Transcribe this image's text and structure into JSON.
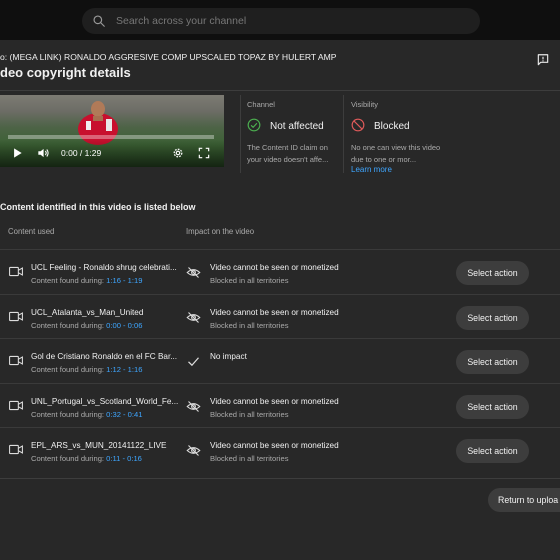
{
  "search": {
    "placeholder": "Search across your channel"
  },
  "dialog": {
    "subtitle": "o: (MEGA LINK) RONALDO AGGRESIVE COMP UPSCALED TOPAZ BY HULERT AMP",
    "title": "deo copyright details"
  },
  "video": {
    "time": "0:00 / 1:29",
    "progress": 0
  },
  "channel": {
    "label": "Channel",
    "value": "Not affected",
    "description": "The Content ID claim on your video doesn't affe..."
  },
  "visibility": {
    "label": "Visibility",
    "value": "Blocked",
    "description": "No one can view this video due to one or mor...",
    "link": "Learn more"
  },
  "content": {
    "section_title": "Content identified in this video is listed below",
    "col_content": "Content used",
    "col_impact": "Impact on the video",
    "found_label": "Content found during: ",
    "rows": [
      {
        "name": "UCL Feeling - Ronaldo shrug celebrati...",
        "range": "1:16 - 1:19",
        "impact_icon": "eye-off-icon",
        "impact_title": "Video cannot be seen or monetized",
        "impact_sub": "Blocked in all territories",
        "action": "Select action"
      },
      {
        "name": "UCL_Atalanta_vs_Man_United",
        "range": "0:00 - 0:06",
        "impact_icon": "eye-off-icon",
        "impact_title": "Video cannot be seen or monetized",
        "impact_sub": "Blocked in all territories",
        "action": "Select action"
      },
      {
        "name": "Gol de Cristiano Ronaldo en el FC Bar...",
        "range": "1:12 - 1:16",
        "impact_icon": "check-icon",
        "impact_title": "No impact",
        "impact_sub": "",
        "action": "Select action"
      },
      {
        "name": "UNL_Portugal_vs_Scotland_World_Fe...",
        "range": "0:32 - 0:41",
        "impact_icon": "eye-off-icon",
        "impact_title": "Video cannot be seen or monetized",
        "impact_sub": "Blocked in all territories",
        "action": "Select action"
      },
      {
        "name": "EPL_ARS_vs_MUN_20141122_LIVE",
        "range": "0:11 - 0:16",
        "impact_icon": "eye-off-icon",
        "impact_title": "Video cannot be seen or monetized",
        "impact_sub": "Blocked in all territories",
        "action": "Select action"
      }
    ]
  },
  "footer": {
    "return_label": "Return to uploa"
  },
  "colors": {
    "accent": "#3ea6ff",
    "ok": "#4caf50",
    "blocked": "#e05a5a"
  }
}
